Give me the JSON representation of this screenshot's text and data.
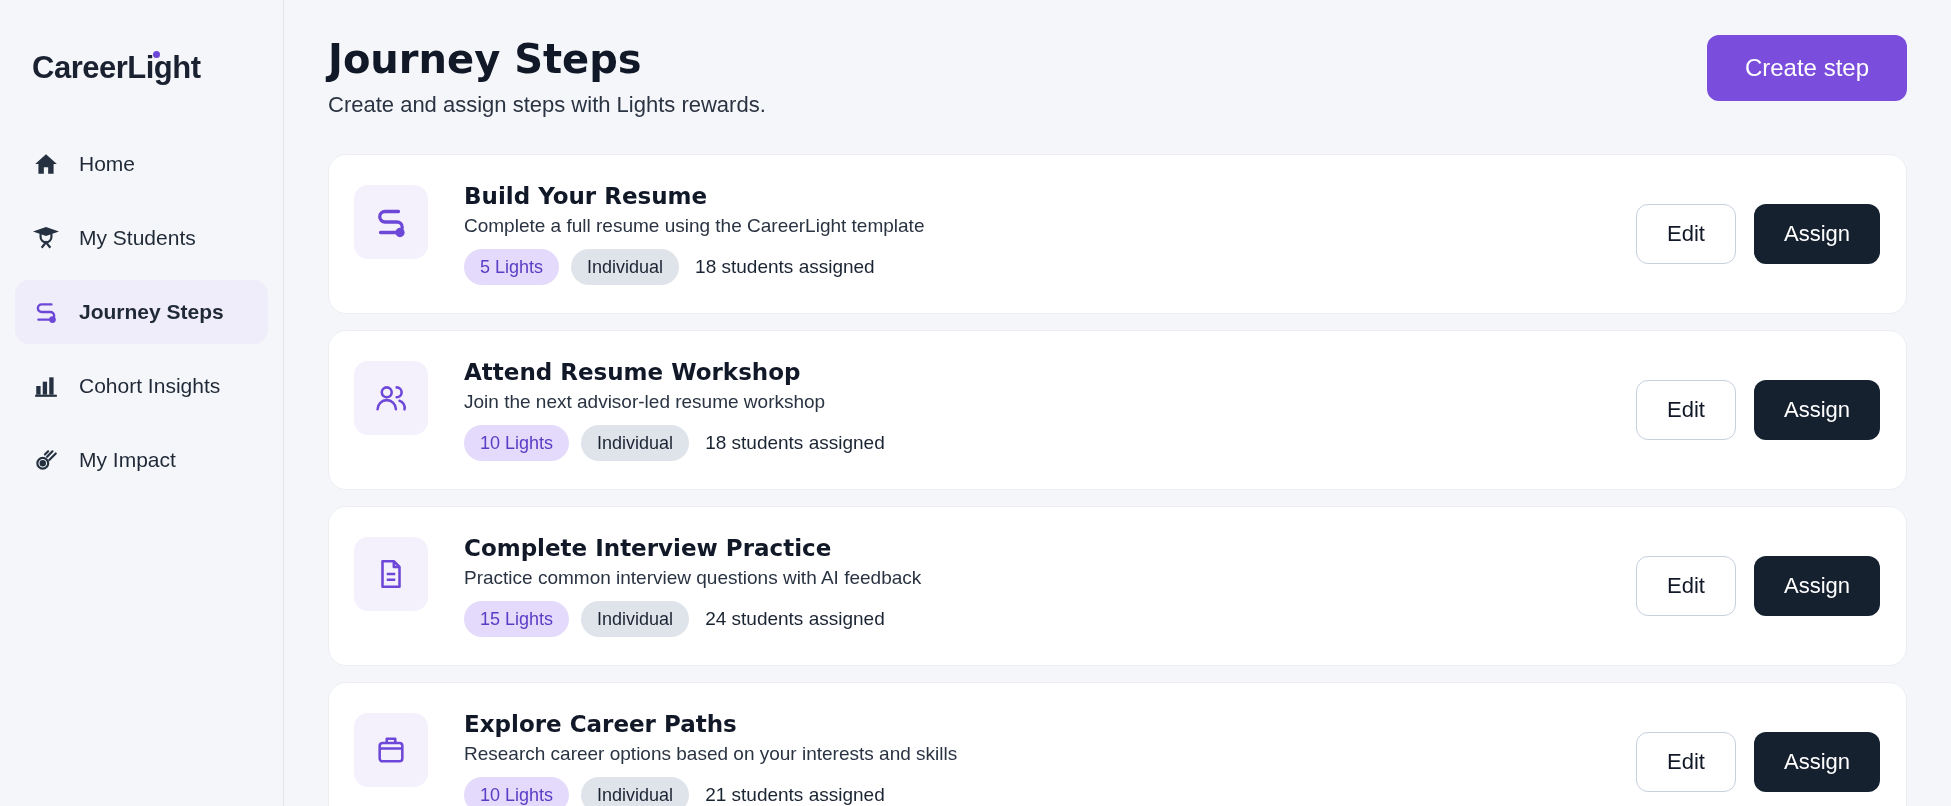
{
  "sidebar": {
    "logo": "CareerLight",
    "items": [
      {
        "label": "Home",
        "selected": false
      },
      {
        "label": "My Students",
        "selected": false
      },
      {
        "label": "Journey Steps",
        "selected": true
      },
      {
        "label": "Cohort Insights",
        "selected": false
      },
      {
        "label": "My Impact",
        "selected": false
      }
    ]
  },
  "header": {
    "title": "Journey Steps",
    "subtitle": "Create and assign steps with Lights rewards.",
    "button": "Create step"
  },
  "steps": [
    {
      "title": "Build Your Resume",
      "description": "Complete a full resume using the CareerLight template",
      "reward": "5 Lights",
      "type": "Individual",
      "assigned": "18 students assigned",
      "edit": "Edit",
      "assign": "Assign"
    },
    {
      "title": "Attend Resume Workshop",
      "description": "Join the next advisor-led resume workshop",
      "reward": "10 Lights",
      "type": "Individual",
      "assigned": "18 students assigned",
      "edit": "Edit",
      "assign": "Assign"
    },
    {
      "title": "Complete Interview Practice",
      "description": "Practice common interview questions with AI feedback",
      "reward": "15 Lights",
      "type": "Individual",
      "assigned": "24 students assigned",
      "edit": "Edit",
      "assign": "Assign"
    },
    {
      "title": "Explore Career Paths",
      "description": "Research career options based on your interests and skills",
      "reward": "10 Lights",
      "type": "Individual",
      "assigned": "21 students assigned",
      "edit": "Edit",
      "assign": "Assign"
    }
  ]
}
